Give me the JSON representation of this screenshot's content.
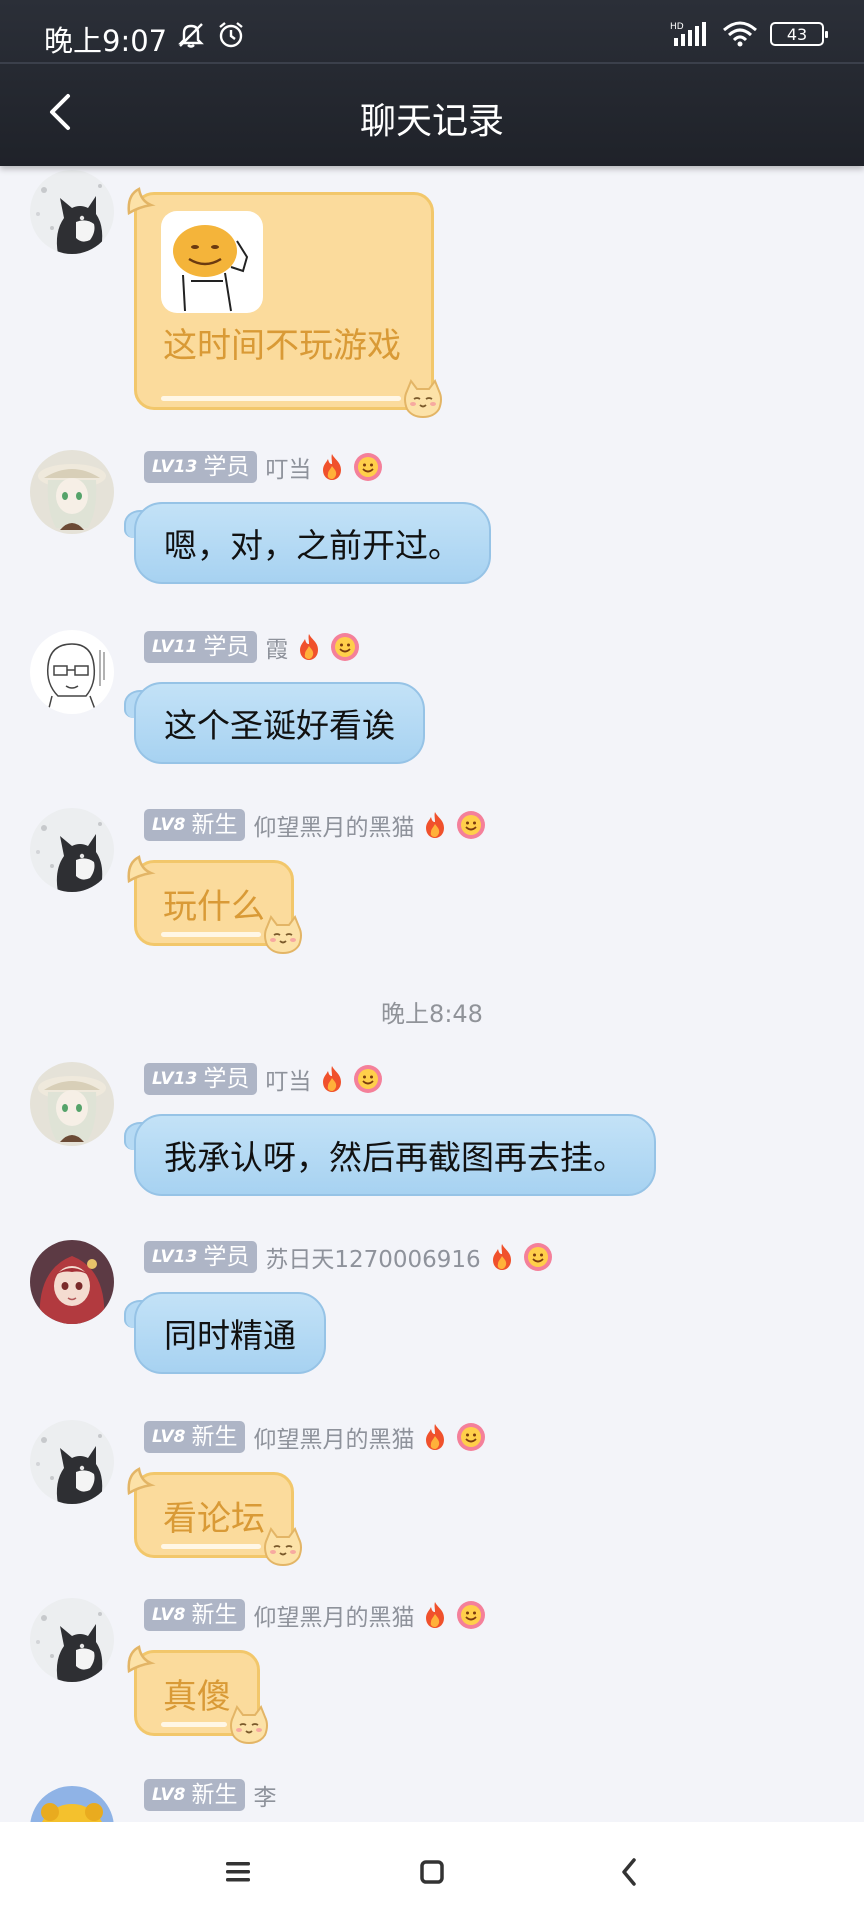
{
  "status_bar": {
    "time": "晚上9:07",
    "battery": "43",
    "network": "HD"
  },
  "header": {
    "title": "聊天记录"
  },
  "chat": {
    "first_bubble_text": "这时间不玩游戏",
    "messages": [
      {
        "lv": "LV13",
        "rank": "学员",
        "nick": "叮当",
        "text": "嗯，对，之前开过。"
      },
      {
        "lv": "LV11",
        "rank": "学员",
        "nick": "霞",
        "text": "这个圣诞好看诶"
      },
      {
        "lv": "LV8",
        "rank": "新生",
        "nick": "仰望黑月的黑猫",
        "text": "玩什么"
      },
      {
        "lv": "LV13",
        "rank": "学员",
        "nick": "叮当",
        "text": "我承认呀，然后再截图再去挂。"
      },
      {
        "lv": "LV13",
        "rank": "学员",
        "nick": "苏日天1270006916",
        "text": "同时精通"
      },
      {
        "lv": "LV8",
        "rank": "新生",
        "nick": "仰望黑月的黑猫",
        "text": "看论坛"
      },
      {
        "lv": "LV8",
        "rank": "新生",
        "nick": "仰望黑月的黑猫",
        "text": "真傻"
      },
      {
        "lv": "LV8",
        "rank": "新生",
        "nick": "李"
      }
    ],
    "timestamp": "晚上8:48"
  },
  "icons": {
    "back": "chevron-left-icon",
    "dnd": "bell-off-icon",
    "alarm": "alarm-icon",
    "signal": "signal-icon",
    "wifi": "wifi-icon",
    "fire": "fire-icon",
    "smile": "smile-flower-icon",
    "menu": "menu-icon",
    "home": "home-icon",
    "nav_back": "nav-back-icon"
  },
  "colors": {
    "header_bg": "#23272f",
    "page_bg": "#f3f4f9",
    "blue_bubble": "#b3d8f3",
    "cat_bubble": "#fbdb9c",
    "cat_text": "#d99a36",
    "level_badge": "#aeb5c6"
  }
}
